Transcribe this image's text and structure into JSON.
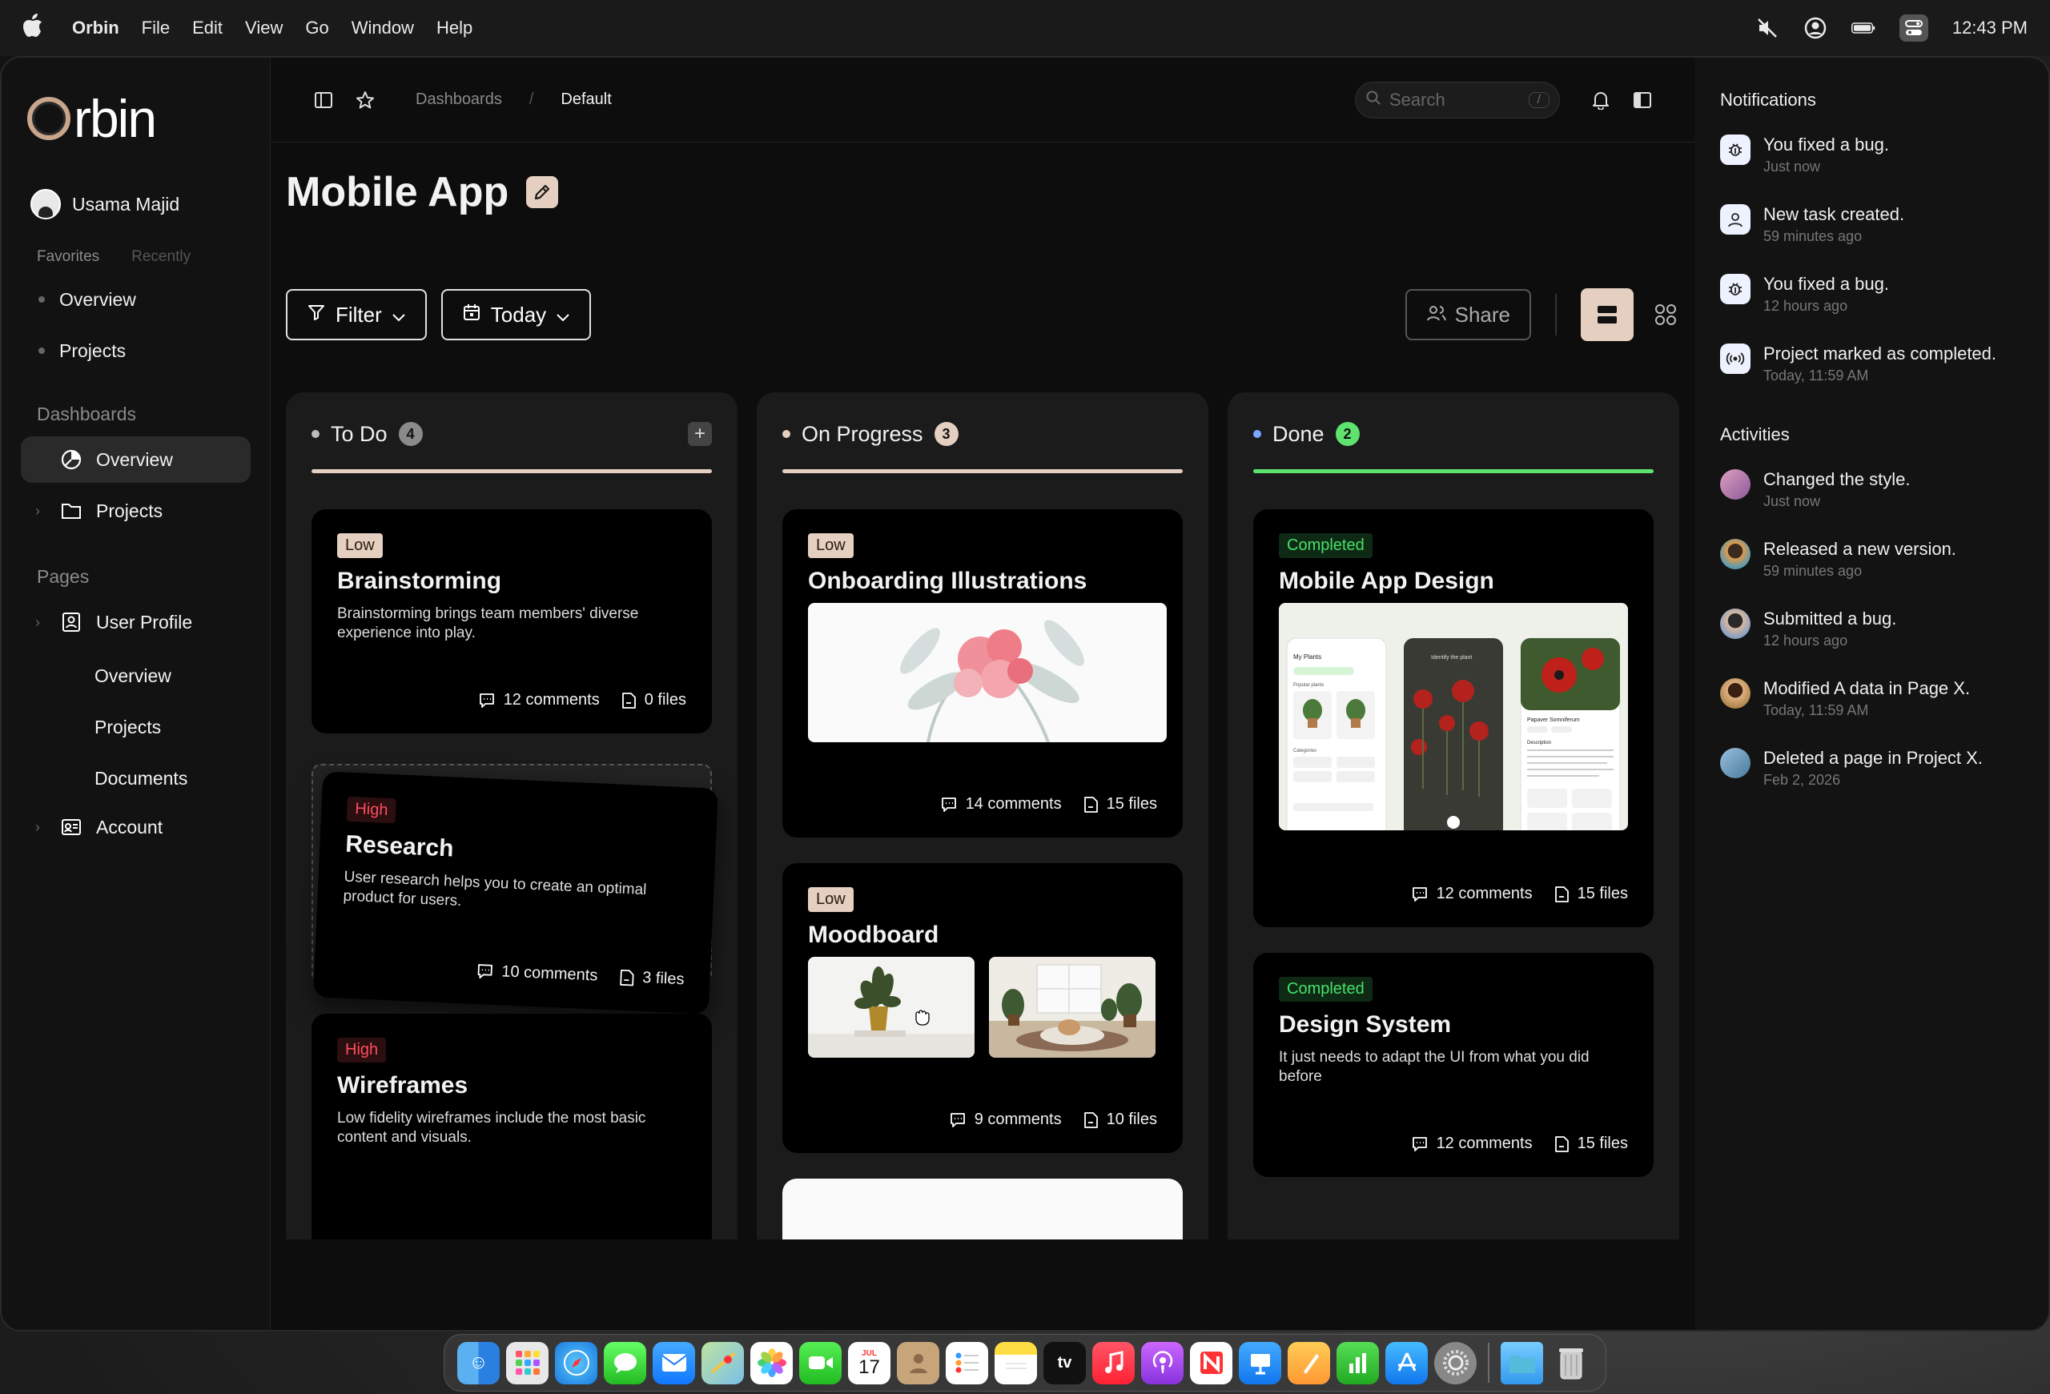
{
  "menubar": {
    "app_name": "Orbin",
    "menus": [
      "File",
      "Edit",
      "View",
      "Go",
      "Window",
      "Help"
    ],
    "time": "12:43 PM"
  },
  "sidebar": {
    "logo": "rbin",
    "user_name": "Usama Majid",
    "tab_favorites": "Favorites",
    "tab_recently": "Recently",
    "favorites": [
      "Overview",
      "Projects"
    ],
    "dashboards_label": "Dashboards",
    "dashboards": [
      "Overview",
      "Projects"
    ],
    "pages_label": "Pages",
    "user_profile": "User Profile",
    "user_profile_sub": [
      "Overview",
      "Projects",
      "Documents"
    ],
    "account": "Account"
  },
  "topbar": {
    "crumb_root": "Dashboards",
    "crumb_sep": "/",
    "crumb_current": "Default",
    "search_placeholder": "Search",
    "search_shortcut": "/"
  },
  "page": {
    "title": "Mobile App",
    "filter_label": "Filter",
    "date_label": "Today",
    "share_label": "Share"
  },
  "columns": [
    {
      "title": "To Do",
      "count": "4",
      "dot_color": "#bdbdbd",
      "line_color": "#e4cfc0",
      "badge_color": "#8a8a8a"
    },
    {
      "title": "On Progress",
      "count": "3",
      "dot_color": "#e4cfc0",
      "line_color": "#e4cfc0",
      "badge_color": "#e4cfc0"
    },
    {
      "title": "Done",
      "count": "2",
      "dot_color": "#7aa7ff",
      "line_color": "#5ee36e",
      "badge_color": "#5ee36e"
    }
  ],
  "cards": {
    "brainstorming": {
      "priority": "Low",
      "title": "Brainstorming",
      "desc": "Brainstorming brings team members' diverse experience into play.",
      "comments": "12 comments",
      "files": "0 files"
    },
    "research": {
      "priority": "High",
      "title": "Research",
      "desc": "User research helps you to create an optimal product for users.",
      "comments": "10 comments",
      "files": "3 files"
    },
    "wireframes": {
      "priority": "High",
      "title": "Wireframes",
      "desc": "Low fidelity wireframes include the most basic content and visuals."
    },
    "onboarding": {
      "priority": "Low",
      "title": "Onboarding Illustrations",
      "comments": "14 comments",
      "files": "15 files"
    },
    "moodboard": {
      "priority": "Low",
      "title": "Moodboard",
      "comments": "9 comments",
      "files": "10 files"
    },
    "mobile_design": {
      "priority": "Completed",
      "title": "Mobile App Design",
      "comments": "12 comments",
      "files": "15 files",
      "mock": {
        "s1_title": "My Plants",
        "s1_sub": "Popular plants",
        "s1_cat": "Categories",
        "s2_title": "Identify the plant",
        "s3_title": "Papaver Somniferum",
        "s3_desc": "Description"
      }
    },
    "design_system": {
      "priority": "Completed",
      "title": "Design System",
      "desc": "It just needs to adapt the UI from what you did before",
      "comments": "12 comments",
      "files": "15 files"
    }
  },
  "notifications": {
    "title": "Notifications",
    "items": [
      {
        "text": "You fixed a bug.",
        "time": "Just now",
        "icon": "bug-icon"
      },
      {
        "text": "New task created.",
        "time": "59 minutes ago",
        "icon": "user-icon"
      },
      {
        "text": "You fixed a bug.",
        "time": "12 hours ago",
        "icon": "bug-icon"
      },
      {
        "text": "Project marked as completed.",
        "time": "Today, 11:59 AM",
        "icon": "broadcast-icon"
      }
    ]
  },
  "activities": {
    "title": "Activities",
    "items": [
      {
        "text": "Changed the style.",
        "time": "Just now",
        "color": "#c48aa8"
      },
      {
        "text": "Released a new version.",
        "time": "59 minutes ago",
        "color": "#e09a4a"
      },
      {
        "text": "Submitted a bug.",
        "time": "12 hours ago",
        "color": "#8aa0c0"
      },
      {
        "text": "Modified A data in Page X.",
        "time": "Today, 11:59 AM",
        "color": "#c9a070"
      },
      {
        "text": "Deleted a page in Project X.",
        "time": "Feb 2, 2026",
        "color": "#7aa6c8"
      }
    ]
  },
  "dock": {
    "calendar_month": "JUL",
    "calendar_day": "17",
    "tv_label": "tv",
    "apps": [
      "finder",
      "launchpad",
      "safari",
      "messages",
      "mail",
      "maps",
      "photos",
      "facetime",
      "calendar",
      "contacts",
      "reminders",
      "notes",
      "tv",
      "music",
      "podcasts",
      "news",
      "keynote",
      "pages",
      "numbers",
      "app-store",
      "system-settings",
      "downloads",
      "trash"
    ]
  }
}
